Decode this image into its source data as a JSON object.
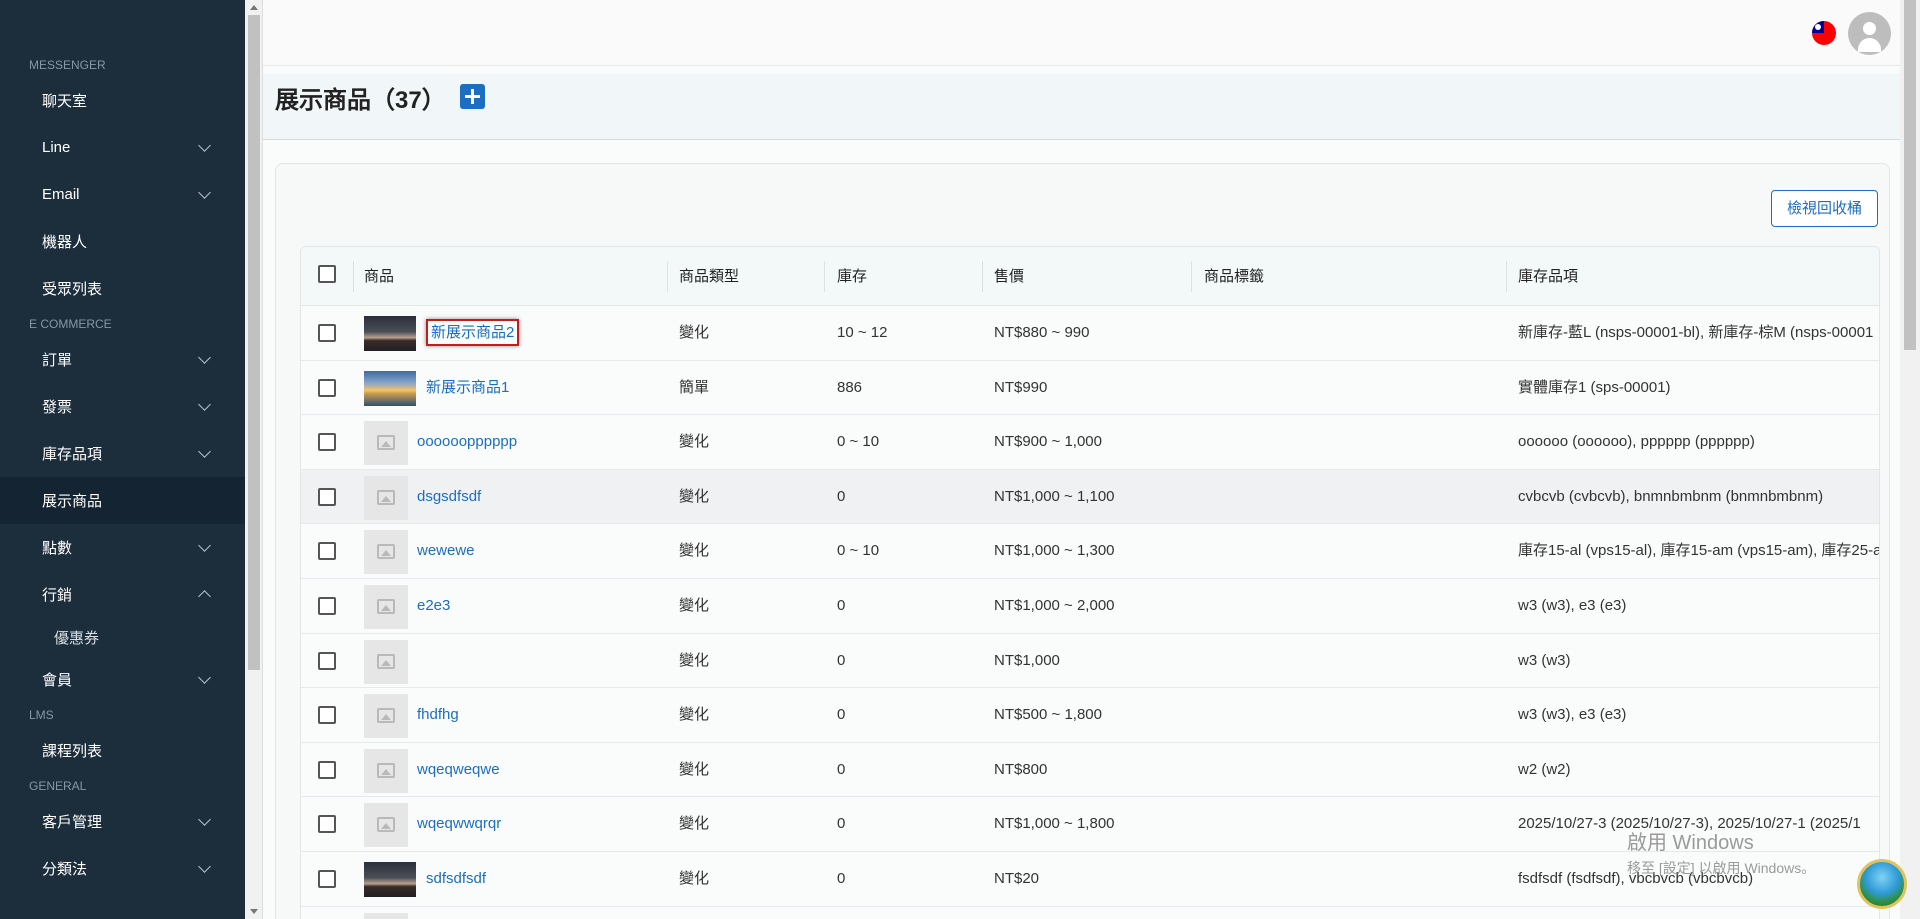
{
  "sidebar": {
    "sections": [
      {
        "label": "MESSENGER",
        "items": [
          {
            "label": "聊天室",
            "has_chevron": false
          },
          {
            "label": "Line",
            "has_chevron": true
          },
          {
            "label": "Email",
            "has_chevron": true
          },
          {
            "label": "機器人",
            "has_chevron": false
          },
          {
            "label": "受眾列表",
            "has_chevron": false
          }
        ]
      },
      {
        "label": "E COMMERCE",
        "items": [
          {
            "label": "訂單",
            "has_chevron": true
          },
          {
            "label": "發票",
            "has_chevron": true
          },
          {
            "label": "庫存品項",
            "has_chevron": true
          },
          {
            "label": "展示商品",
            "has_chevron": false,
            "active": true
          },
          {
            "label": "點數",
            "has_chevron": true
          },
          {
            "label": "行銷",
            "has_chevron": true,
            "expanded": true,
            "children": [
              "優惠券"
            ]
          },
          {
            "label": "會員",
            "has_chevron": true
          }
        ]
      },
      {
        "label": "LMS",
        "items": [
          {
            "label": "課程列表",
            "has_chevron": false
          }
        ]
      },
      {
        "label": "GENERAL",
        "items": [
          {
            "label": "客戶管理",
            "has_chevron": true
          },
          {
            "label": "分類法",
            "has_chevron": true
          }
        ]
      }
    ]
  },
  "header": {
    "language_flag": "taiwan-flag-icon",
    "avatar_icon": "user-avatar-icon"
  },
  "page": {
    "title": "展示商品（37）",
    "add_icon": "plus-icon",
    "recycle_button": "檢視回收桶"
  },
  "table": {
    "columns": [
      "商品",
      "商品類型",
      "庫存",
      "售價",
      "商品標籤",
      "庫存品項"
    ],
    "rows": [
      {
        "name": "新展示商品2",
        "thumb": "volcano",
        "type": "變化",
        "stock": "10 ~ 12",
        "price": "NT$880 ~ 990",
        "tags": "",
        "inventory": "新庫存-藍L (nsps-00001-bl), 新庫存-棕M (nsps-00001",
        "highlighted": true
      },
      {
        "name": "新展示商品1",
        "thumb": "sunset",
        "type": "簡單",
        "stock": "886",
        "price": "NT$990",
        "tags": "",
        "inventory": "實體庫存1 (sps-00001)"
      },
      {
        "name": "oooooopppppp",
        "thumb": "placeholder",
        "type": "變化",
        "stock": "0 ~ 10",
        "price": "NT$900 ~ 1,000",
        "tags": "",
        "inventory": "oooooo (oooooo), pppppp (pppppp)"
      },
      {
        "name": "dsgsdfsdf",
        "thumb": "placeholder",
        "type": "變化",
        "stock": "0",
        "price": "NT$1,000 ~ 1,100",
        "tags": "",
        "inventory": "cvbcvb (cvbcvb), bnmnbmbnm (bnmnbmbnm)",
        "hover": true
      },
      {
        "name": "wewewe",
        "thumb": "placeholder",
        "type": "變化",
        "stock": "0 ~ 10",
        "price": "NT$1,000 ~ 1,300",
        "tags": "",
        "inventory": "庫存15-al (vps15-al), 庫存15-am (vps15-am), 庫存25-a"
      },
      {
        "name": "e2e3",
        "thumb": "placeholder",
        "type": "變化",
        "stock": "0",
        "price": "NT$1,000 ~ 2,000",
        "tags": "",
        "inventory": "w3 (w3), e3 (e3)"
      },
      {
        "name": "",
        "thumb": "placeholder",
        "type": "變化",
        "stock": "0",
        "price": "NT$1,000",
        "tags": "",
        "inventory": "w3 (w3)"
      },
      {
        "name": "fhdfhg",
        "thumb": "placeholder",
        "type": "變化",
        "stock": "0",
        "price": "NT$500 ~ 1,800",
        "tags": "",
        "inventory": "w3 (w3), e3 (e3)"
      },
      {
        "name": "wqeqweqwe",
        "thumb": "placeholder",
        "type": "變化",
        "stock": "0",
        "price": "NT$800",
        "tags": "",
        "inventory": "w2 (w2)"
      },
      {
        "name": "wqeqwwqrqr",
        "thumb": "placeholder",
        "type": "變化",
        "stock": "0",
        "price": "NT$1,000 ~ 1,800",
        "tags": "",
        "inventory": "2025/10/27-3 (2025/10/27-3), 2025/10/27-1 (2025/1"
      },
      {
        "name": "sdfsdfsdf",
        "thumb": "volcano",
        "type": "變化",
        "stock": "0",
        "price": "NT$20",
        "tags": "",
        "inventory": "fsdfsdf (fsdfsdf), vbcbvcb (vbcbvcb)"
      },
      {
        "name": "",
        "thumb": "placeholder",
        "type": "",
        "stock": "",
        "price": "",
        "tags": "",
        "inventory": ""
      }
    ]
  },
  "watermark": {
    "line1": "啟用 Windows",
    "line2": "移至 [設定] 以啟用 Windows。"
  }
}
